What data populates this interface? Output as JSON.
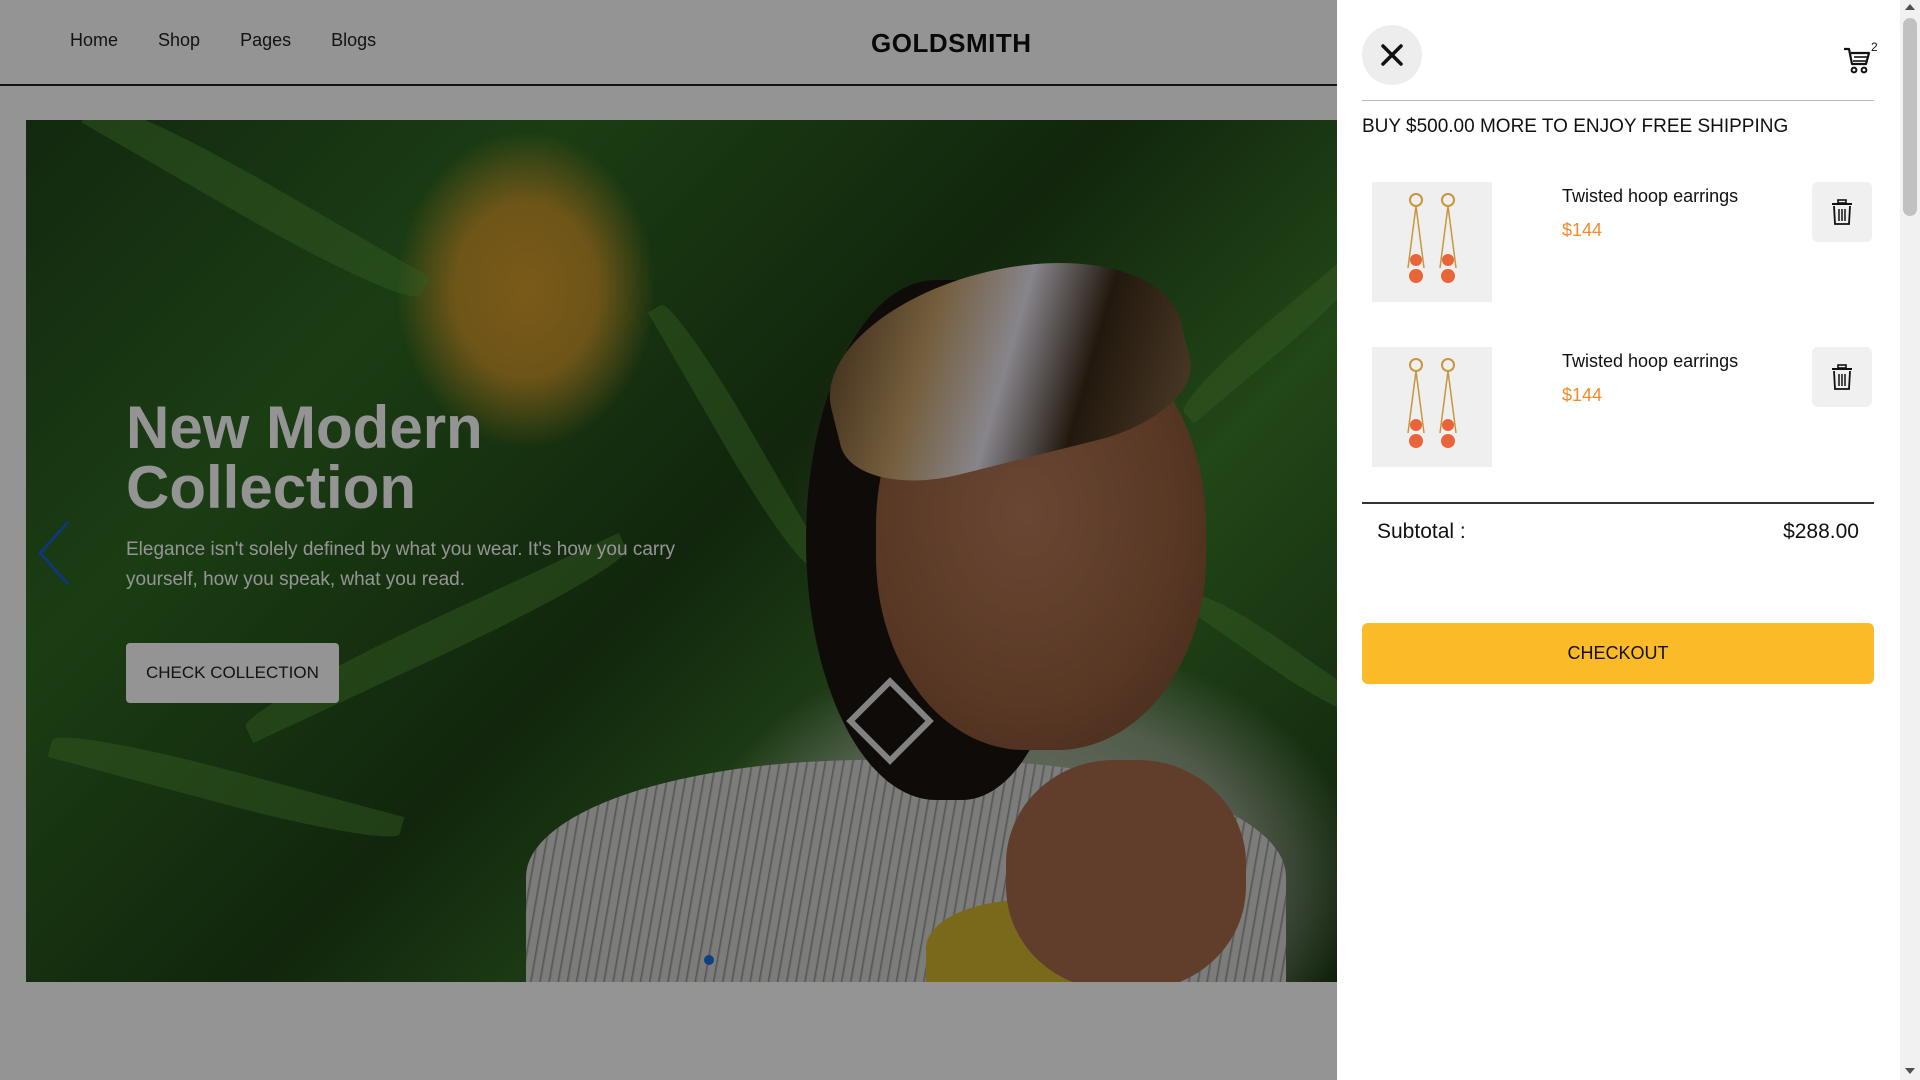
{
  "nav": {
    "links": [
      "Home",
      "Shop",
      "Pages",
      "Blogs"
    ],
    "brand": "GOLDSMITH"
  },
  "hero": {
    "title": "New Modern Collection",
    "subtitle": "Elegance isn't solely defined by what you wear. It's how you carry yourself, how you speak, what you read.",
    "button_label": "CHECK COLLECTION",
    "prev_icon": "chevron-left-icon",
    "active_dot_color": "#1a6fe0"
  },
  "cart": {
    "close_icon": "close-icon",
    "cart_icon": "cart-icon",
    "count": "2",
    "shipping_message": "BUY $500.00 MORE TO ENJOY FREE SHIPPING",
    "items": [
      {
        "name": "Twisted hoop earrings",
        "price": "$144"
      },
      {
        "name": "Twisted hoop earrings",
        "price": "$144"
      }
    ],
    "delete_icon": "trash-icon",
    "subtotal_label": "Subtotal :",
    "subtotal_value": "$288.00",
    "checkout_label": "CHECKOUT",
    "accent_color": "#fbba27",
    "price_color": "#f28a2a"
  }
}
